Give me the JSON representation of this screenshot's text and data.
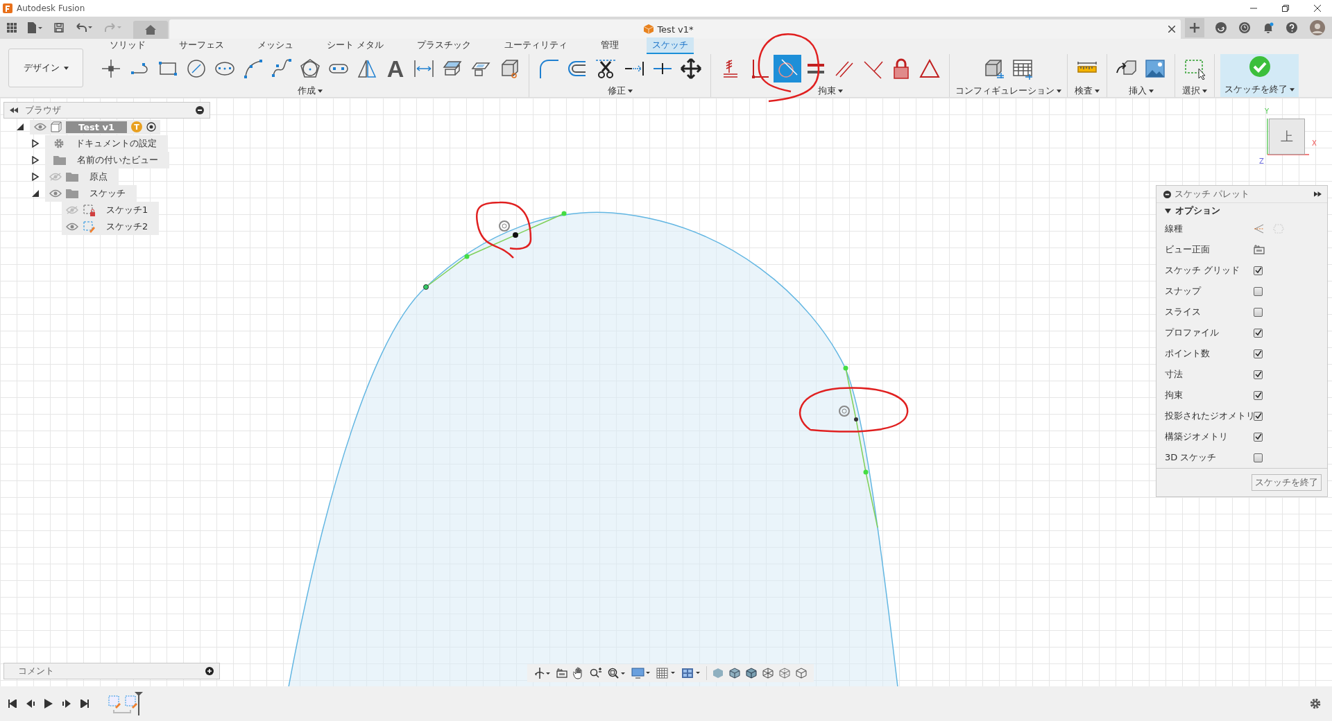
{
  "app_title": "Autodesk Fusion",
  "document_tab": {
    "title": "Test v1*"
  },
  "toolbar": {
    "workspace": "デザイン",
    "tabs": [
      {
        "label": "ソリッド",
        "selected": false
      },
      {
        "label": "サーフェス",
        "selected": false
      },
      {
        "label": "メッシュ",
        "selected": false
      },
      {
        "label": "シート メタル",
        "selected": false
      },
      {
        "label": "プラスチック",
        "selected": false
      },
      {
        "label": "ユーティリティ",
        "selected": false
      },
      {
        "label": "管理",
        "selected": false
      },
      {
        "label": "スケッチ",
        "selected": true
      }
    ],
    "groups": [
      {
        "kind": "tools",
        "label": "作成",
        "tools": [
          {
            "kind": "point",
            "selected": false
          },
          {
            "kind": "line",
            "selected": false
          },
          {
            "kind": "rectangle",
            "selected": false
          },
          {
            "kind": "circle",
            "selected": false
          },
          {
            "kind": "ellipse",
            "selected": false
          },
          {
            "kind": "arc",
            "selected": false
          },
          {
            "kind": "spline",
            "selected": false
          },
          {
            "kind": "polygon",
            "selected": false
          },
          {
            "kind": "slot",
            "selected": false
          },
          {
            "kind": "mirror",
            "selected": false
          },
          {
            "kind": "text",
            "glyph": "A",
            "selected": false
          },
          {
            "kind": "dimension",
            "selected": false
          },
          {
            "kind": "project",
            "selected": false
          },
          {
            "kind": "include",
            "selected": false
          },
          {
            "kind": "box",
            "selected": false
          }
        ]
      },
      {
        "kind": "tools",
        "label": "修正",
        "tools": [
          {
            "kind": "fillet",
            "selected": false
          },
          {
            "kind": "offset",
            "selected": false
          },
          {
            "kind": "trim",
            "selected": false
          },
          {
            "kind": "extend",
            "selected": false
          },
          {
            "kind": "break",
            "selected": false
          },
          {
            "kind": "move",
            "selected": false
          }
        ]
      },
      {
        "kind": "tools",
        "label": "拘束",
        "tools": [
          {
            "kind": "hatch",
            "selected": false
          },
          {
            "kind": "perpendicular",
            "selected": false
          },
          {
            "kind": "tangent",
            "selected": true
          },
          {
            "kind": "equal",
            "selected": false
          },
          {
            "kind": "parallel",
            "selected": false
          },
          {
            "kind": "angle",
            "selected": false
          },
          {
            "kind": "lock",
            "selected": false
          },
          {
            "kind": "triangle",
            "selected": false
          }
        ]
      },
      {
        "kind": "tools",
        "label": "コンフィギュレーション",
        "tools": [
          {
            "kind": "cubetable",
            "selected": false
          },
          {
            "kind": "table",
            "selected": false
          }
        ]
      },
      {
        "kind": "tools",
        "label": "検査",
        "tools": [
          {
            "kind": "ruler",
            "selected": false
          }
        ]
      },
      {
        "kind": "tools",
        "label": "挿入",
        "tools": [
          {
            "kind": "insert",
            "selected": false
          },
          {
            "kind": "image",
            "selected": false
          }
        ]
      },
      {
        "kind": "tools",
        "label": "選択",
        "tools": [
          {
            "kind": "select",
            "selected": false
          }
        ]
      },
      {
        "kind": "finish",
        "label": "スケッチを終了"
      }
    ]
  },
  "browser": {
    "title": "ブラウザ",
    "tree": [
      {
        "label": "Test v1",
        "kind": "component",
        "badge": "T",
        "visible": true,
        "expanded": true,
        "selected": true,
        "children": [
          {
            "label": "ドキュメントの設定",
            "kind": "settings",
            "expanded": false,
            "selected": false
          },
          {
            "label": "名前の付いたビュー",
            "kind": "folder",
            "expanded": false,
            "selected": false
          },
          {
            "label": "原点",
            "kind": "folder",
            "visible": false,
            "expanded": false,
            "selected": false
          },
          {
            "label": "スケッチ",
            "kind": "folder",
            "visible": true,
            "expanded": true,
            "selected": false,
            "children": [
              {
                "label": "スケッチ1",
                "kind": "sketch",
                "visible": false,
                "editing": false,
                "selected": false
              },
              {
                "label": "スケッチ2",
                "kind": "sketch",
                "visible": true,
                "editing": true,
                "selected": false
              }
            ]
          }
        ]
      }
    ]
  },
  "viewcube": {
    "face": "上",
    "axis_labels": [
      "Y",
      "X",
      "Z"
    ]
  },
  "palette": {
    "title": "スケッチ パレット",
    "section": {
      "label": "オプション",
      "expanded": true
    },
    "rows": [
      {
        "label": "線種",
        "kind": "linetype"
      },
      {
        "label": "ビュー正面",
        "kind": "look-at"
      },
      {
        "label": "スケッチ グリッド",
        "kind": "checkbox",
        "checked": true
      },
      {
        "label": "スナップ",
        "kind": "checkbox",
        "checked": false
      },
      {
        "label": "スライス",
        "kind": "checkbox",
        "checked": false
      },
      {
        "label": "プロファイル",
        "kind": "checkbox",
        "checked": true
      },
      {
        "label": "ポイント数",
        "kind": "checkbox",
        "checked": true
      },
      {
        "label": "寸法",
        "kind": "checkbox",
        "checked": true
      },
      {
        "label": "拘束",
        "kind": "checkbox",
        "checked": true
      },
      {
        "label": "投影されたジオメトリ",
        "kind": "checkbox",
        "checked": true
      },
      {
        "label": "構築ジオメトリ",
        "kind": "checkbox",
        "checked": true
      },
      {
        "label": "3D スケッチ",
        "kind": "checkbox",
        "checked": false
      }
    ],
    "finish_button": "スケッチを終了"
  },
  "comments": {
    "title": "コメント"
  }
}
